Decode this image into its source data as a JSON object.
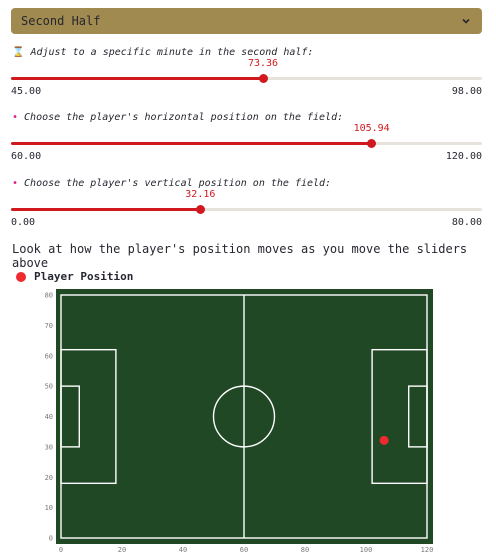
{
  "half_select": {
    "value": "Second Half",
    "icon": "chevron-down-icon"
  },
  "sliders": [
    {
      "icon": "⌛",
      "icon_name": "hourglass-icon",
      "label": "Adjust to a specific minute in the second half:",
      "min_label": "45.00",
      "max_label": "98.00",
      "value_label": "73.36",
      "fraction": 0.5351
    },
    {
      "icon": "•",
      "icon_name": "pin-icon",
      "label": "Choose the player's horizontal position on the field:",
      "min_label": "60.00",
      "max_label": "120.00",
      "value_label": "105.94",
      "fraction": 0.7657
    },
    {
      "icon": "•",
      "icon_name": "pin-icon",
      "label": "Choose the player's vertical position on the field:",
      "min_label": "0.00",
      "max_label": "80.00",
      "value_label": "32.16",
      "fraction": 0.402
    }
  ],
  "heading": "Look at how the player's position moves as you move the sliders above",
  "chart_data": {
    "type": "scatter",
    "legend": [
      "Player Position"
    ],
    "x_ticks": [
      "0",
      "20",
      "40",
      "60",
      "80",
      "100",
      "120"
    ],
    "y_ticks": [
      "0",
      "10",
      "20",
      "30",
      "40",
      "50",
      "60",
      "70",
      "80"
    ],
    "xlim": [
      0,
      120
    ],
    "ylim": [
      0,
      80
    ],
    "points": [
      {
        "x": 105.94,
        "y": 32.16
      }
    ],
    "colors": {
      "pitch": "#204824",
      "lines": "#ffffff",
      "point": "#ef2a2f"
    }
  }
}
